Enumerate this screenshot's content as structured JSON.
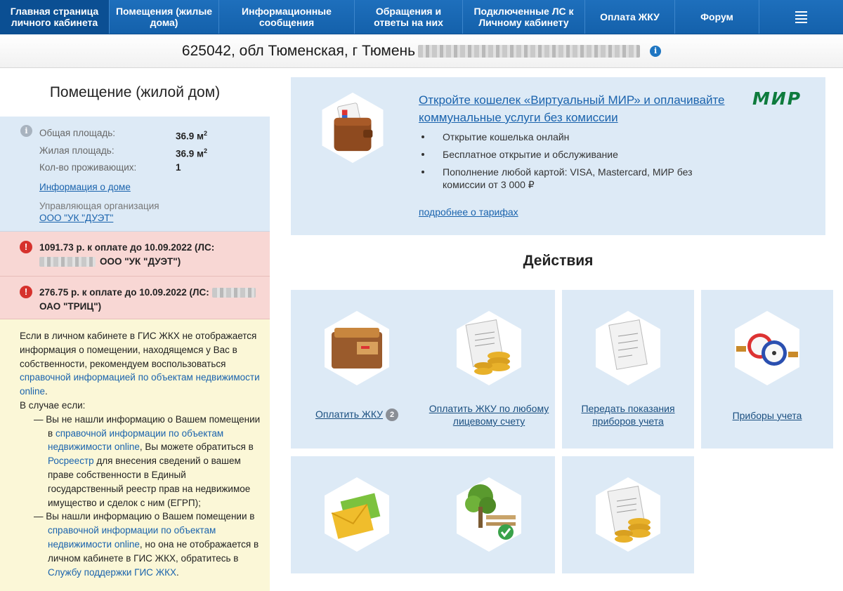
{
  "nav": {
    "items": [
      {
        "label": "Главная страница личного кабинета"
      },
      {
        "label": "Помещения (жилые дома)"
      },
      {
        "label": "Информационные сообщения"
      },
      {
        "label": "Обращения и ответы на них"
      },
      {
        "label": "Подключенные ЛС к Личному кабинету"
      },
      {
        "label": "Оплата ЖКУ"
      },
      {
        "label": "Форум"
      }
    ],
    "menu_icon": "hamburger-icon",
    "bg_color": "#1565b0"
  },
  "address": {
    "text": "625042, обл Тюменская, г Тюмень",
    "info_icon": "i"
  },
  "left": {
    "title": "Помещение (жилой дом)",
    "info_icon": "i",
    "stats": [
      {
        "label": "Общая площадь:",
        "value": "36.9 м",
        "unit_sup": "2"
      },
      {
        "label": "Жилая площадь:",
        "value": "36.9 м",
        "unit_sup": "2"
      },
      {
        "label": "Кол-во проживающих:",
        "value": "1",
        "unit_sup": ""
      }
    ],
    "house_link": "Информация о доме",
    "mgmt_label": "Управляющая организация",
    "mgmt_link": "ООО \"УК \"ДУЭТ\"",
    "debts": [
      {
        "line1": "1091.73 р. к оплате до 10.09.2022 (ЛС:",
        "line2": "ООО \"УК \"ДУЭТ\")"
      },
      {
        "line1": "276.75 р. к оплате до 10.09.2022 (ЛС:",
        "line2": "ОАО \"ТРИЦ\")"
      }
    ],
    "note": {
      "p1_text": "Если в личном кабинете в ГИС ЖКХ не отображается информация о помещении, находящемся у Вас в собственности, рекомендуем воспользоваться",
      "p1_link": "справочной информацией по объектам недвижимости online",
      "p2": "В случае если:",
      "b1_a": "— Вы не нашли информацию о Вашем помещении в",
      "b1_link1": "справочной информации по объектам недвижимости online",
      "b1_b": ", Вы можете обратиться в",
      "b1_link2": "Росреестр",
      "b1_c": "для внесения сведений о вашем праве собственности в Единый государственный реестр прав на недвижимое имущество и сделок с ним (ЕГРП);",
      "b2_a": "— Вы нашли информацию о Вашем помещении в",
      "b2_link1": "справочной информации по объектам недвижимости online",
      "b2_b": ", но она не отображается в личном кабинете в ГИС ЖКХ, обратитесь в",
      "b2_link2": "Службу поддержки ГИС ЖКХ",
      "b2_c": "."
    }
  },
  "promo": {
    "title": "Откройте кошелек «Виртуальный МИР» и оплачивайте коммунальные услуги без комиссии",
    "bullets": [
      "Открытие кошелька онлайн",
      "Бесплатное открытие и обслуживание",
      "Пополнение любой картой: VISA, Mastercard, МИР без комиссии от 3 000 ₽"
    ],
    "more_link": "подробнее о тарифах",
    "logo_text": "МИР",
    "logo_color": "#0e7b3d"
  },
  "actions": {
    "title": "Действия",
    "tiles": [
      {
        "label": "Оплатить ЖКУ",
        "badge": "2"
      },
      {
        "label": "Оплатить ЖКУ по любому лицевому счету"
      },
      {
        "label": "Передать показания приборов учета"
      },
      {
        "label": "Приборы учета"
      }
    ]
  }
}
